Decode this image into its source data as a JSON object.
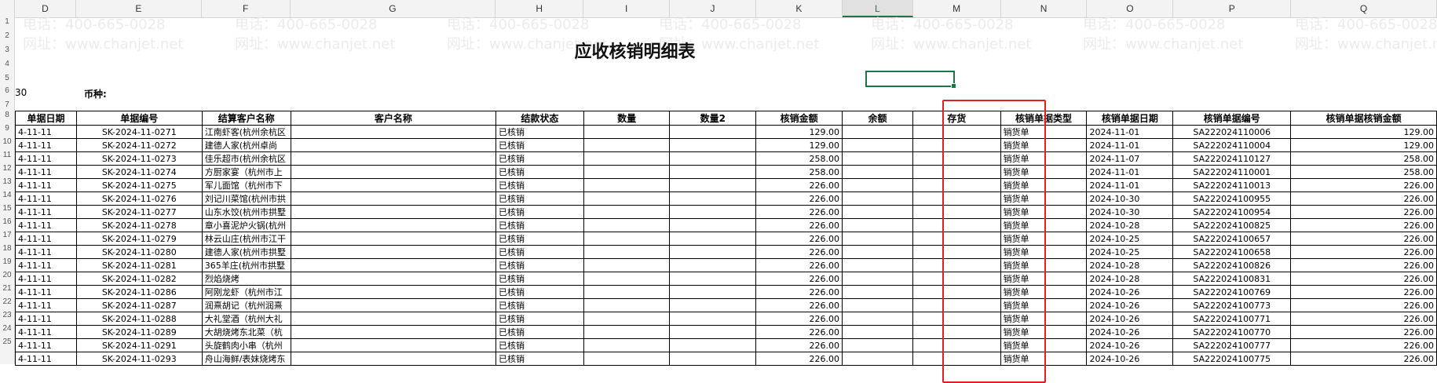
{
  "sheet": {
    "title": "应收核销明细表",
    "currency_label": "币种:",
    "left_cell_fragment": "30",
    "active_column": "L"
  },
  "column_letters": [
    "D",
    "E",
    "F",
    "G",
    "H",
    "I",
    "J",
    "K",
    "L",
    "M",
    "N",
    "O",
    "P",
    "Q"
  ],
  "row_numbers": [
    "1",
    "2",
    "3",
    "4",
    "5",
    "6",
    "7",
    "8",
    "9",
    "10",
    "11",
    "12",
    "13",
    "14",
    "15",
    "16",
    "17",
    "18",
    "19",
    "20",
    "21",
    "22",
    "23",
    "24",
    "25"
  ],
  "watermark": {
    "phone": "电话：400-665-0028",
    "site": "网址：www.chanjet.net"
  },
  "table": {
    "headers": [
      "单据日期",
      "单据编号",
      "结算客户名称",
      "客户名称",
      "结款状态",
      "数量",
      "数量2",
      "核销金额",
      "余额",
      "存货",
      "核销单据类型",
      "核销单据日期",
      "核销单据编号",
      "核销单据核销金额"
    ],
    "rows": [
      [
        "4-11-11",
        "SK-2024-11-0271",
        "江南虾客(杭州余杭区",
        "",
        "已核销",
        "",
        "",
        "129.00",
        "",
        "",
        "销货单",
        "2024-11-01",
        "SA222024110006",
        "129.00"
      ],
      [
        "4-11-11",
        "SK-2024-11-0272",
        "建德人家(杭州卓尚",
        "",
        "已核销",
        "",
        "",
        "129.00",
        "",
        "",
        "销货单",
        "2024-11-01",
        "SA222024110004",
        "129.00"
      ],
      [
        "4-11-11",
        "SK-2024-11-0273",
        "佳乐超市(杭州余杭区",
        "",
        "已核销",
        "",
        "",
        "258.00",
        "",
        "",
        "销货单",
        "2024-11-07",
        "SA222024110127",
        "258.00"
      ],
      [
        "4-11-11",
        "SK-2024-11-0274",
        "方厨家宴（杭州市上",
        "",
        "已核销",
        "",
        "",
        "258.00",
        "",
        "",
        "销货单",
        "2024-11-01",
        "SA222024110001",
        "258.00"
      ],
      [
        "4-11-11",
        "SK-2024-11-0275",
        "军儿面馆（杭州市下",
        "",
        "已核销",
        "",
        "",
        "226.00",
        "",
        "",
        "销货单",
        "2024-11-01",
        "SA222024110013",
        "226.00"
      ],
      [
        "4-11-11",
        "SK-2024-11-0276",
        "刘记川菜馆(杭州市拱",
        "",
        "已核销",
        "",
        "",
        "226.00",
        "",
        "",
        "销货单",
        "2024-10-30",
        "SA222024100955",
        "226.00"
      ],
      [
        "4-11-11",
        "SK-2024-11-0277",
        "山东水饺(杭州市拱墅",
        "",
        "已核销",
        "",
        "",
        "226.00",
        "",
        "",
        "销货单",
        "2024-10-30",
        "SA222024100954",
        "226.00"
      ],
      [
        "4-11-11",
        "SK-2024-11-0278",
        "章小喜泥炉火锅(杭州",
        "",
        "已核销",
        "",
        "",
        "226.00",
        "",
        "",
        "销货单",
        "2024-10-28",
        "SA222024100825",
        "226.00"
      ],
      [
        "4-11-11",
        "SK-2024-11-0279",
        "林云山庄(杭州市江干",
        "",
        "已核销",
        "",
        "",
        "226.00",
        "",
        "",
        "销货单",
        "2024-10-25",
        "SA222024100657",
        "226.00"
      ],
      [
        "4-11-11",
        "SK-2024-11-0280",
        "建德人家(杭州市拱墅",
        "",
        "已核销",
        "",
        "",
        "226.00",
        "",
        "",
        "销货单",
        "2024-10-25",
        "SA222024100658",
        "226.00"
      ],
      [
        "4-11-11",
        "SK-2024-11-0281",
        "365羊庄(杭州市拱墅",
        "",
        "已核销",
        "",
        "",
        "226.00",
        "",
        "",
        "销货单",
        "2024-10-28",
        "SA222024100826",
        "226.00"
      ],
      [
        "4-11-11",
        "SK-2024-11-0282",
        "烈焰烧烤",
        "",
        "已核销",
        "",
        "",
        "226.00",
        "",
        "",
        "销货单",
        "2024-10-28",
        "SA222024100831",
        "226.00"
      ],
      [
        "4-11-11",
        "SK-2024-11-0286",
        "阿刚龙虾（杭州市江",
        "",
        "已核销",
        "",
        "",
        "226.00",
        "",
        "",
        "销货单",
        "2024-10-26",
        "SA222024100769",
        "226.00"
      ],
      [
        "4-11-11",
        "SK-2024-11-0287",
        "润熹胡记（杭州润熹",
        "",
        "已核销",
        "",
        "",
        "226.00",
        "",
        "",
        "销货单",
        "2024-10-26",
        "SA222024100773",
        "226.00"
      ],
      [
        "4-11-11",
        "SK-2024-11-0288",
        "大礼堂酒（杭州大礼",
        "",
        "已核销",
        "",
        "",
        "226.00",
        "",
        "",
        "销货单",
        "2024-10-26",
        "SA222024100771",
        "226.00"
      ],
      [
        "4-11-11",
        "SK-2024-11-0289",
        "大胡烧烤东北菜（杭",
        "",
        "已核销",
        "",
        "",
        "226.00",
        "",
        "",
        "销货单",
        "2024-10-26",
        "SA222024100770",
        "226.00"
      ],
      [
        "4-11-11",
        "SK-2024-11-0291",
        "头旋鹤肉小串（杭州",
        "",
        "已核销",
        "",
        "",
        "226.00",
        "",
        "",
        "销货单",
        "2024-10-26",
        "SA222024100777",
        "226.00"
      ],
      [
        "4-11-11",
        "SK-2024-11-0293",
        "舟山海鲜/表妹烧烤东",
        "",
        "已核销",
        "",
        "",
        "226.00",
        "",
        "",
        "销货单",
        "2024-10-26",
        "SA222024100775",
        "226.00"
      ]
    ]
  }
}
